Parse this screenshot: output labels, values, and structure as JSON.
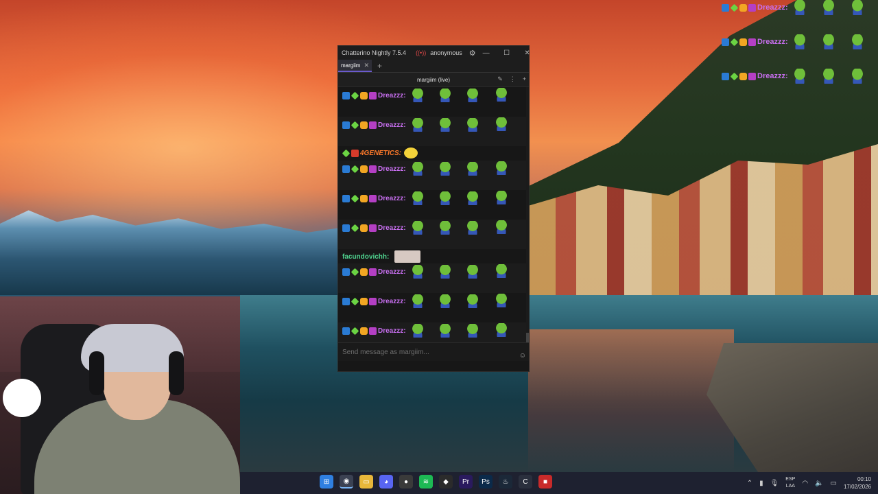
{
  "window": {
    "title": "Chatterino Nightly 7.5.4",
    "account": "anonymous",
    "controls": {
      "minimize": "—",
      "maximize": "☐",
      "close": "✕"
    }
  },
  "tabs": [
    {
      "label": "margiim",
      "close": "✕"
    }
  ],
  "add_tab": "+",
  "split": {
    "title": "margiim (live)"
  },
  "chat": {
    "messages": [
      {
        "user": "Dreazzz:",
        "kind": "dreazzz"
      },
      {
        "user": "Dreazzz:",
        "kind": "dreazzz"
      },
      {
        "user": "4GENETICS:",
        "kind": "genetics"
      },
      {
        "user": "Dreazzz:",
        "kind": "dreazzz"
      },
      {
        "user": "Dreazzz:",
        "kind": "dreazzz"
      },
      {
        "user": "Dreazzz:",
        "kind": "dreazzz"
      },
      {
        "user": "facundovichh:",
        "kind": "facundo"
      },
      {
        "user": "Dreazzz:",
        "kind": "dreazzz"
      },
      {
        "user": "Dreazzz:",
        "kind": "dreazzz"
      },
      {
        "user": "Dreazzz:",
        "kind": "dreazzz"
      }
    ],
    "input_placeholder": "Send message as margiim..."
  },
  "overlay_chat": [
    {
      "user": "Dreazzz:"
    },
    {
      "user": "Dreazzz:"
    },
    {
      "user": "Dreazzz:"
    }
  ],
  "taskbar": {
    "apps": [
      "windows-start",
      "chrome",
      "file-explorer",
      "discord",
      "obs",
      "spotify",
      "media",
      "premiere",
      "photoshop",
      "steam",
      "chatterino",
      "recorder"
    ],
    "language": {
      "line1": "ESP",
      "line2": "LAA"
    },
    "time": "00:10",
    "date": "17/02/2026"
  },
  "colors": {
    "dreazzz": "#c86ff0",
    "genetics": "#ff7a2a",
    "facundo": "#4fd38f",
    "window_bg": "#171717"
  }
}
